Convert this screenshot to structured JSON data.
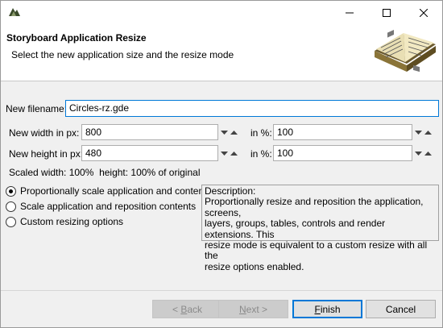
{
  "header": {
    "title": "Storyboard Application Resize",
    "subtitle": "Select the new application size and the resize mode"
  },
  "filename": {
    "label": "New filename:",
    "value": "Circles-rz.gde"
  },
  "width": {
    "label": "New width in px:",
    "value": "800",
    "pct_label": "in %:",
    "pct_value": "100"
  },
  "height": {
    "label": "New height in px:",
    "value": "480",
    "pct_label": "in %:",
    "pct_value": "100"
  },
  "scaled_text": "Scaled width: 100%  height: 100% of original",
  "modes": [
    {
      "label": "Proportionally scale application and contents",
      "selected": true
    },
    {
      "label": "Scale application and reposition contents",
      "selected": false
    },
    {
      "label": "Custom resizing options",
      "selected": false
    }
  ],
  "description": {
    "heading": "Description:",
    "lines": [
      "Proportionally resize and reposition the application, screens,",
      "layers, groups, tables, controls and render extensions. This",
      "resize mode is equivalent to a custom resize with all the",
      "resize options enabled."
    ]
  },
  "buttons": {
    "back_arrow": "< ",
    "back_ul": "B",
    "back_rest": "ack",
    "next_ul": "N",
    "next_rest": "ext >",
    "finish_ul": "F",
    "finish_rest": "inish",
    "cancel": "Cancel"
  },
  "icons": {
    "app": "storyboard-app-icon",
    "minimize": "minimize-icon",
    "maximize": "maximize-icon",
    "close": "close-icon",
    "header_art": "open-book-icon",
    "spinner": "spinner-arrows-icon"
  }
}
